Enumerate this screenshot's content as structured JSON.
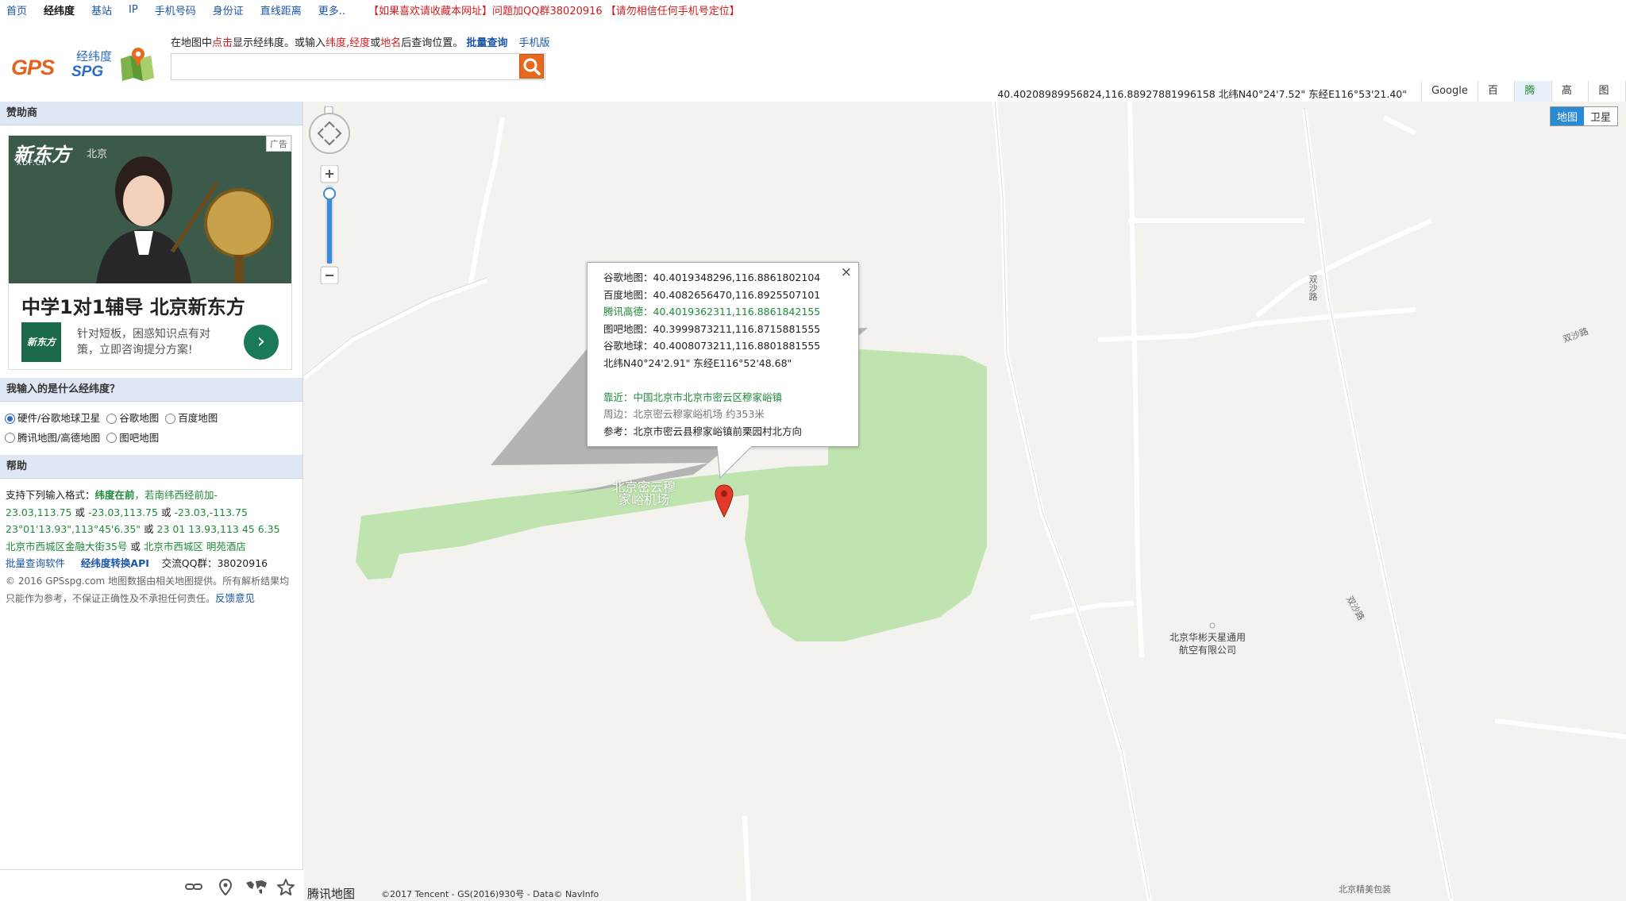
{
  "topnav": {
    "links": [
      "首页",
      "经纬度",
      "基站",
      "IP",
      "手机号码",
      "身份证",
      "直线距离",
      "更多.."
    ],
    "notice": "【如果喜欢请收藏本网址】问题加QQ群38020916 【请勿相信任何手机号定位】"
  },
  "logo": {
    "gps": "GPS",
    "spg": "SPG",
    "cn": "经纬度"
  },
  "hint": {
    "p1": "在地图中",
    "click": "点击",
    "p2": "显示经纬度。或输入",
    "latlng": "纬度,经度",
    "p3": "或",
    "place": "地名",
    "p4": "后查询位置。",
    "batch": "批量查询",
    "mobile": "手机版"
  },
  "search": {
    "value": "",
    "placeholder": ""
  },
  "coordline": "40.40208989956824,116.88927881996158 北纬N40°24'7.52\" 东经E116°53'21.40\"",
  "maptabs": [
    "Google",
    "百度",
    "腾讯",
    "高德",
    "图吧"
  ],
  "sidebar": {
    "sponsor_title": "赞助商",
    "ad": {
      "badge": "广告",
      "brand": "新东方",
      "brand_sub": "XDF.CN",
      "city": "北京",
      "title": "中学1对1辅导 北京新东方",
      "mini_logo": "新东方",
      "desc": "针对短板，困惑知识点有对策，立即咨询提分方案!",
      "go": "›"
    },
    "radio_title": "我输入的是什么经纬度？",
    "radios": [
      "硬件/谷歌地球卫星",
      "谷歌地图",
      "百度地图",
      "腾讯地图/高德地图",
      "图吧地图"
    ],
    "help_title": "帮助",
    "help": {
      "l1a": "支持下列输入格式：",
      "l1b": "纬度在前",
      "l1c": "，若南纬西经前加-",
      "l2": "23.03,113.75",
      "l2or1": " 或 ",
      "l2b": "-23.03,113.75",
      "l2or2": " 或 ",
      "l2c": "-23.03,-113.75",
      "l3a": "23°01'13.93\",113°45'6.35\"",
      "l3or": " 或 ",
      "l3b": "23 01 13.93,113 45 6.35",
      "l4a": "北京市西城区金融大街35号",
      "l4or": " 或 ",
      "l4b": "北京市西城区 明苑酒店",
      "l5a": "批量查询软件",
      "l5b": "经纬度转换API",
      "l5c": "交流QQ群：38020916",
      "l6": "© 2016 GPSspg.com 地图数据由相关地图提供。所有解析结果均只能作为参考，不保证正确性及不承担任何责任。",
      "l6link": "反馈意见"
    }
  },
  "map": {
    "type_buttons": [
      "地图",
      "卫星"
    ],
    "popup": {
      "rows": [
        "谷歌地图：40.4019348296,116.8861802104",
        "百度地图：40.4082656470,116.8925507101",
        "腾讯高德：40.4019362311,116.8861842155",
        "图吧地图：40.3999873211,116.8715881555",
        "谷歌地球：40.4008073211,116.8801881555",
        "北纬N40°24'2.91\" 东经E116°52'48.68\""
      ],
      "near": "靠近：中国北京市北京市密云区穆家峪镇",
      "around": "周边：北京密云穆家峪机场 约353米",
      "ref": "参考：北京市密云县穆家峪镇前栗园村北方向",
      "close": "×"
    },
    "labels": {
      "airport_1": "北京密云穆",
      "airport_2": "家峪机场",
      "company_1": "北京华彬天星通用",
      "company_2": "航空有限公司",
      "road_a": "双沙路",
      "road_b": "双沙路",
      "road_c": "双沙路",
      "road_d": "北京精美包装"
    },
    "attribution": {
      "logo": "腾讯地图",
      "text": "©2017 Tencent - GS(2016)930号 - Data© NavInfo"
    }
  },
  "colors": {
    "accent": "#2a8bd4",
    "green_area": "#bfe4b0",
    "link": "#1a55a8",
    "warning": "#d21d1d",
    "ok_green": "#1f8a3a"
  }
}
